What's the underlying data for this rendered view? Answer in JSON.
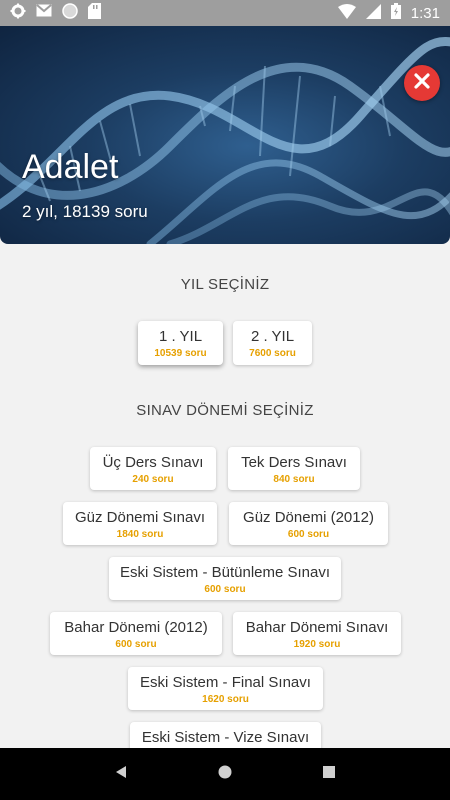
{
  "status_bar": {
    "time": "1:31",
    "icons_left": [
      "gear-icon",
      "gmail-icon",
      "circle-icon",
      "sd-card-icon"
    ],
    "icons_right": [
      "wifi-icon",
      "signal-icon",
      "battery-icon"
    ]
  },
  "header": {
    "title": "Adalet",
    "subtitle": "2 yıl, 18139 soru",
    "close_icon": "close-icon"
  },
  "year_section": {
    "title": "YIL SEÇİNİZ",
    "options": [
      {
        "label": "1 . YIL",
        "count": "10539 soru"
      },
      {
        "label": "2 . YIL",
        "count": "7600 soru"
      }
    ]
  },
  "exam_section": {
    "title": "SINAV DÖNEMİ SEÇİNİZ",
    "options": [
      {
        "label": "Üç Ders Sınavı",
        "count": "240 soru"
      },
      {
        "label": "Tek Ders Sınavı",
        "count": "840 soru"
      },
      {
        "label": "Güz Dönemi Sınavı",
        "count": "1840 soru"
      },
      {
        "label": "Güz Dönemi (2012)",
        "count": "600 soru"
      },
      {
        "label": "Eski Sistem - Bütünleme Sınavı",
        "count": "600 soru"
      },
      {
        "label": "Bahar Dönemi (2012)",
        "count": "600 soru"
      },
      {
        "label": "Bahar Dönemi Sınavı",
        "count": "1920 soru"
      },
      {
        "label": "Eski Sistem - Final Sınavı",
        "count": "1620 soru"
      },
      {
        "label": "Eski Sistem - Vize Sınavı",
        "count": ""
      }
    ]
  },
  "nav_bar": {
    "buttons": [
      "back-icon",
      "home-icon",
      "recents-icon"
    ]
  },
  "colors": {
    "accent": "#e6a000",
    "close": "#e53935",
    "status_bar": "#9e9e9e"
  }
}
